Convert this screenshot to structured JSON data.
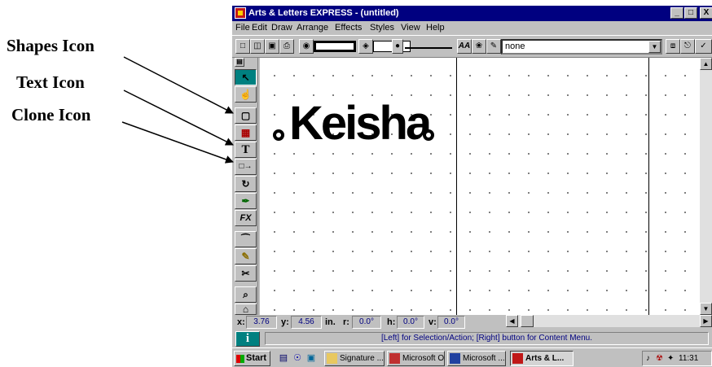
{
  "annotations": {
    "shapes": "Shapes Icon",
    "text": "Text Icon",
    "clone": "Clone Icon"
  },
  "window": {
    "title": "Arts & Letters EXPRESS - (untitled)",
    "controls": [
      "_",
      "□",
      "X"
    ]
  },
  "menu": [
    "File",
    "Edit",
    "Draw",
    "Arrange",
    "Effects",
    "Styles",
    "View",
    "Help"
  ],
  "toolbar": {
    "style_value": "none",
    "text_style_label": "AA"
  },
  "toolbox": [
    {
      "name": "selection-tool",
      "glyph": "↖",
      "selected": true
    },
    {
      "name": "hand-tool",
      "glyph": "☝"
    },
    {
      "name": "shapes-tool",
      "glyph": "▢"
    },
    {
      "name": "clipart-tool",
      "glyph": "▦"
    },
    {
      "name": "text-tool",
      "glyph": "T"
    },
    {
      "name": "clone-tool",
      "glyph": "□→"
    },
    {
      "name": "rotate-tool",
      "glyph": "↻"
    },
    {
      "name": "fill-tool",
      "glyph": "✒"
    },
    {
      "name": "fx-tool",
      "glyph": "FX"
    },
    {
      "name": "curve-tool",
      "glyph": "⁀"
    },
    {
      "name": "pen-tool",
      "glyph": "✎"
    },
    {
      "name": "knife-tool",
      "glyph": "✂"
    },
    {
      "name": "zoom-tool",
      "glyph": "⌕"
    },
    {
      "name": "lock-tool",
      "glyph": "⌂"
    }
  ],
  "canvas": {
    "text": "Keisha"
  },
  "coordinates": {
    "x_label": "x:",
    "x_value": "3.76",
    "y_label": "y:",
    "y_value": "4.56",
    "unit": "in.",
    "r_label": "r:",
    "r_value": "0.0°",
    "h_label": "h:",
    "h_value": "0.0°",
    "v_label": "v:",
    "v_value": "0.0°"
  },
  "status": {
    "message": "[Left] for Selection/Action; [Right] button for Content Menu.",
    "info_label": "i"
  },
  "taskbar": {
    "start": "Start",
    "tasks": [
      "Signature ...",
      "Microsoft O...",
      "Microsoft ...",
      "Arts & L..."
    ],
    "clock": "11:31 AM"
  },
  "colors": {
    "title_bar": "#000080",
    "selected_tool": "#008080",
    "chrome": "#c0c0c0"
  }
}
